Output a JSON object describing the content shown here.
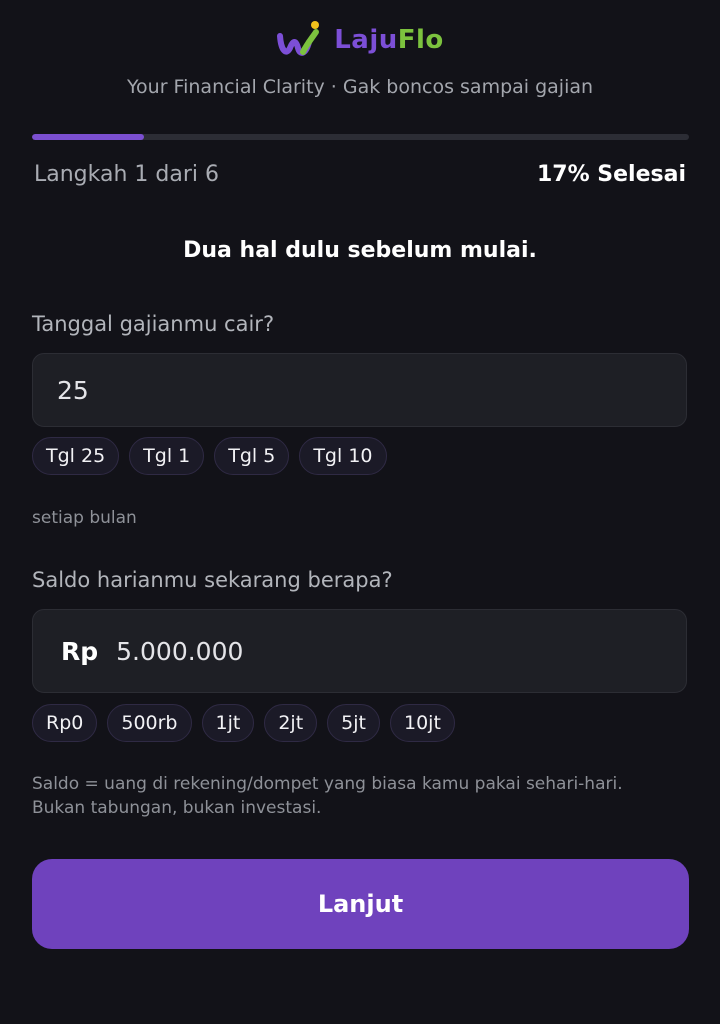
{
  "brand": {
    "name_part1": "Laju",
    "name_part2": "Flo",
    "tagline": "Your Financial Clarity · Gak boncos sampai gajian",
    "colors": {
      "purple": "#7c4fd6",
      "green": "#7cc23e",
      "yellow": "#f2c21c"
    }
  },
  "progress": {
    "step_label": "Langkah 1 dari 6",
    "percent_label": "17% Selesai",
    "fraction": 0.17,
    "color": "#7b4fd0"
  },
  "intro": "Dua hal dulu sebelum mulai.",
  "payday": {
    "label": "Tanggal gajianmu cair?",
    "value": "25",
    "chips": [
      "Tgl 25",
      "Tgl 1",
      "Tgl 5",
      "Tgl 10"
    ],
    "helper": "setiap bulan"
  },
  "balance": {
    "label": "Saldo harianmu sekarang berapa?",
    "prefix": "Rp",
    "value": "5.000.000",
    "chips": [
      "Rp0",
      "500rb",
      "1jt",
      "2jt",
      "5jt",
      "10jt"
    ],
    "helper_line1": "Saldo = uang di rekening/dompet yang biasa kamu pakai sehari-hari.",
    "helper_line2": "Bukan tabungan, bukan investasi."
  },
  "cta": {
    "label": "Lanjut",
    "color": "#6f42bd"
  }
}
